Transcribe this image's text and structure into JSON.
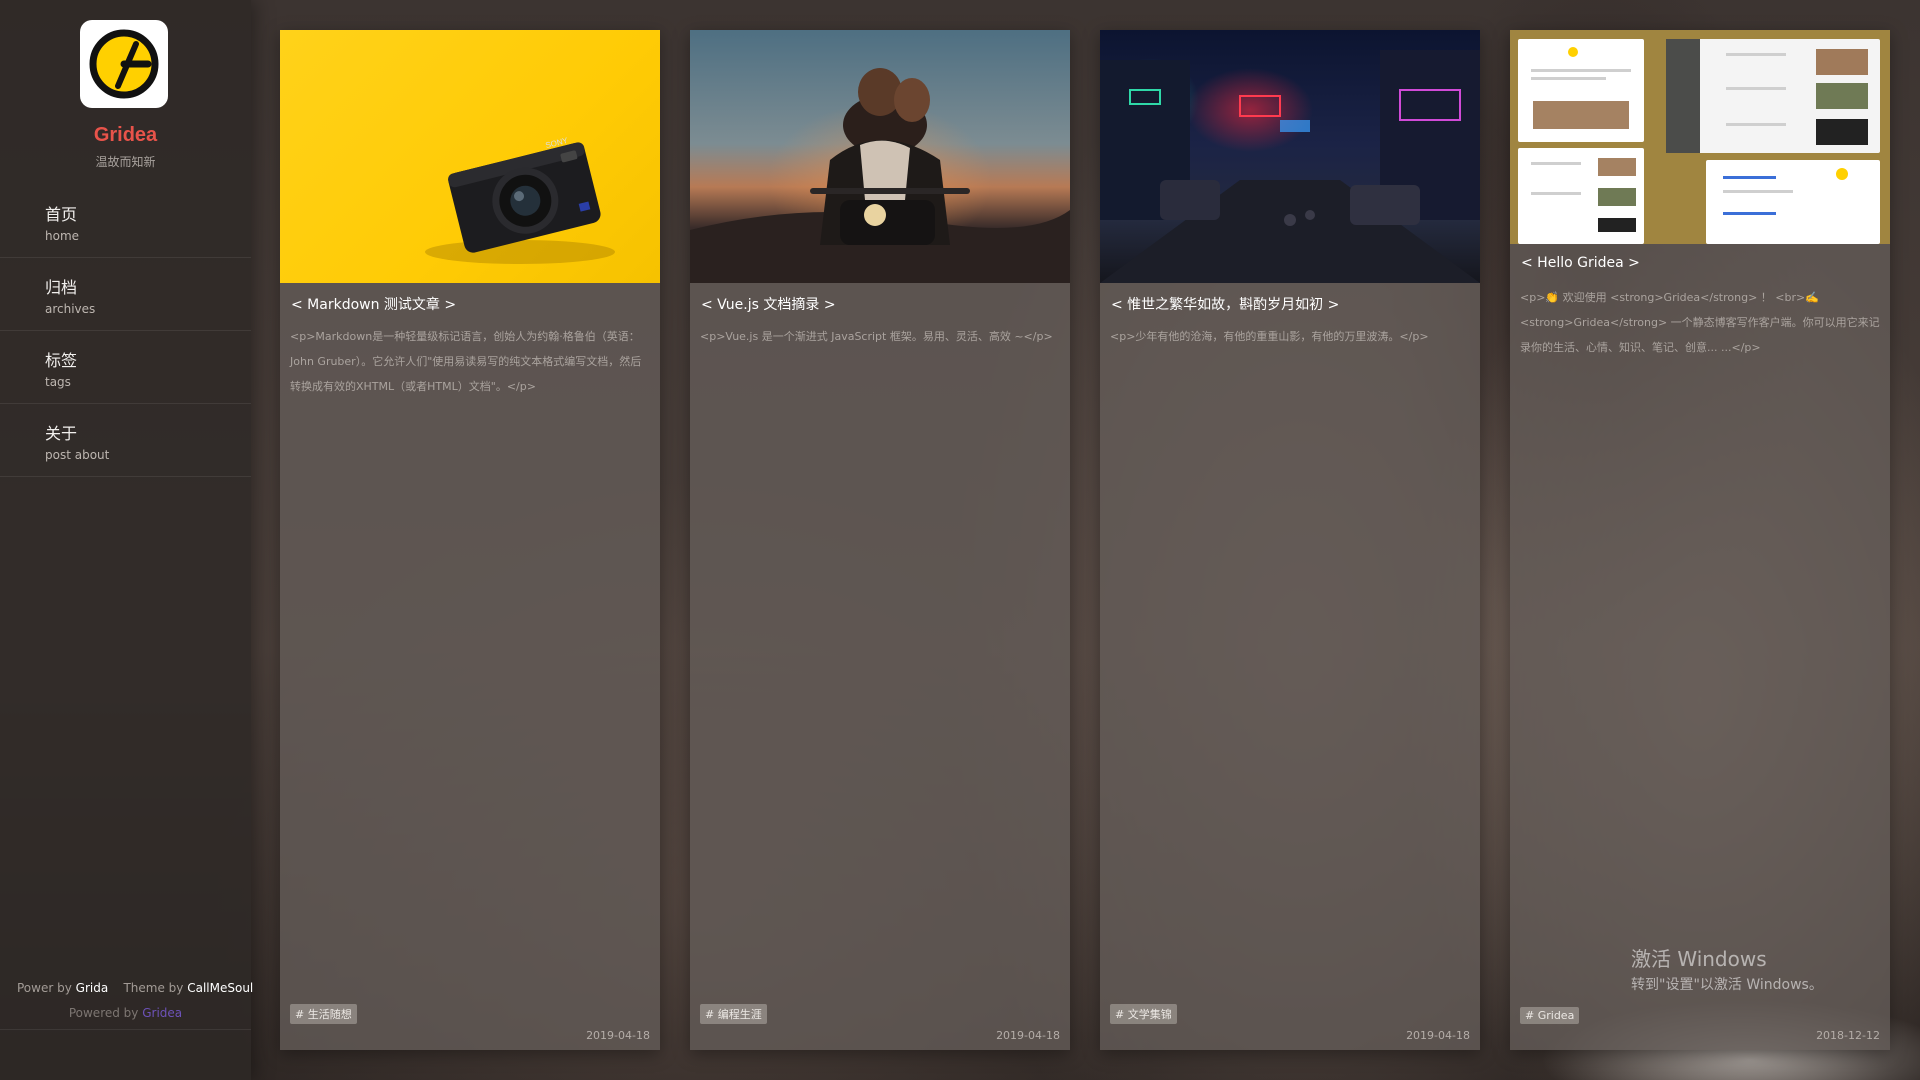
{
  "site": {
    "name": "Gridea",
    "description": "温故而知新"
  },
  "nav": [
    {
      "label_cn": "首页",
      "label_en": "home"
    },
    {
      "label_cn": "归档",
      "label_en": "archives"
    },
    {
      "label_cn": "标签",
      "label_en": "tags"
    },
    {
      "label_cn": "关于",
      "label_en": "post about"
    }
  ],
  "footer": {
    "power_prefix": "Power by",
    "power_name": "Grida",
    "theme_prefix": "Theme by",
    "theme_name": "CallMeSoul",
    "powered_prefix": "Powered by",
    "powered_name": "Gridea"
  },
  "posts": [
    {
      "title": "< Markdown 测试文章 >",
      "excerpt": "<p>Markdown是一种轻量级标记语言，创始人为约翰·格鲁伯（英语：John Gruber）。它允许人们\"使用易读易写的纯文本格式编写文档，然后转换成有效的XHTML（或者HTML）文档\"。</p>",
      "tag": "# 生活随想",
      "date": "2019-04-18",
      "image": "yellow-camera",
      "camera_brand": "SONY"
    },
    {
      "title": "< Vue.js 文档摘录 >",
      "excerpt": "<p>Vue.js 是一个渐进式 JavaScript 框架。易用、灵活、高效 ~</p>",
      "tag": "# 编程生涯",
      "date": "2019-04-18",
      "image": "motorcycle-sunset"
    },
    {
      "title": "< 惟世之繁华如故，斟酌岁月如初 >",
      "excerpt": "<p>少年有他的沧海，有他的重重山影，有他的万里波涛。</p>",
      "tag": "# 文学集锦",
      "date": "2019-04-18",
      "image": "neon-street"
    },
    {
      "title": "< Hello Gridea >",
      "excerpt": "<p>👏 欢迎使用 <strong>Gridea</strong> ！ <br>✍️ <strong>Gridea</strong> 一个静态博客写作客户端。你可以用它来记录你的生活、心情、知识、笔记、创意... ...</p>",
      "tag": "# Gridea",
      "date": "2018-12-12",
      "image": "gridea-screenshots"
    }
  ],
  "watermark": {
    "line1": "激活 Windows",
    "line2": "转到\"设置\"以激活 Windows。"
  },
  "colors": {
    "accent": "#e8534a",
    "logo_yellow": "#ffd000",
    "powered_link": "#6d52b8"
  },
  "icons": [
    "gridea-logo-icon",
    "camera-icon"
  ]
}
